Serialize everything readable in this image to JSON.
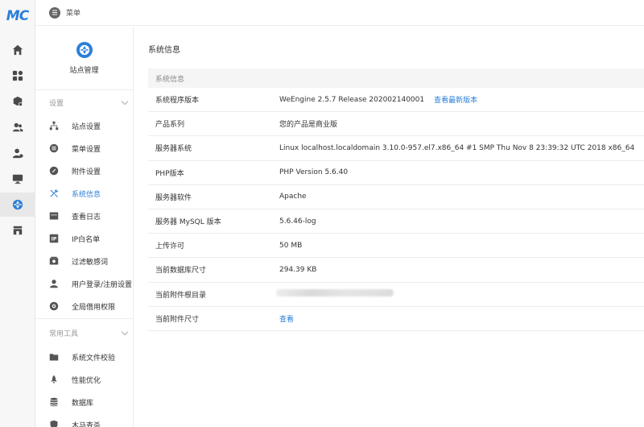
{
  "app": {
    "logo_text": "MC"
  },
  "topbar": {
    "title": "菜单",
    "icon": "menu-icon"
  },
  "rail": {
    "items": [
      {
        "name": "home-icon"
      },
      {
        "name": "apps-icon"
      },
      {
        "name": "package-icon"
      },
      {
        "name": "users-icon"
      },
      {
        "name": "user-settings-icon"
      },
      {
        "name": "monitor-icon"
      },
      {
        "name": "globe-icon",
        "active": true
      },
      {
        "name": "store-icon"
      }
    ]
  },
  "sidebar": {
    "site_label": "站点管理",
    "group_settings": "设置",
    "group_tools": "常用工具",
    "items": [
      {
        "label": "站点设置",
        "icon": "sitemap-icon"
      },
      {
        "label": "菜单设置",
        "icon": "menu-list-icon"
      },
      {
        "label": "附件设置",
        "icon": "attachment-icon"
      },
      {
        "label": "系统信息",
        "icon": "wrench-icon",
        "active": true
      },
      {
        "label": "查看日志",
        "icon": "log-icon"
      },
      {
        "label": "IP白名单",
        "icon": "ip-icon"
      },
      {
        "label": "过滤敏感词",
        "icon": "filter-icon"
      },
      {
        "label": "用户登录/注册设置",
        "icon": "user-icon"
      },
      {
        "label": "全局借用权限",
        "icon": "permission-icon"
      }
    ],
    "tools": [
      {
        "label": "系统文件校验",
        "icon": "folder-icon"
      },
      {
        "label": "性能优化",
        "icon": "rocket-icon"
      },
      {
        "label": "数据库",
        "icon": "database-icon"
      },
      {
        "label": "木马查杀",
        "icon": "shield-icon"
      }
    ]
  },
  "main": {
    "page_title": "系统信息",
    "table_header": "系统信息",
    "rows": [
      {
        "key": "系统程序版本",
        "value": "WeEngine 2.5.7 Release 202002140001",
        "link": "查看最新版本"
      },
      {
        "key": "产品系列",
        "value": "您的产品是商业版"
      },
      {
        "key": "服务器系统",
        "value": "Linux localhost.localdomain 3.10.0-957.el7.x86_64 #1 SMP Thu Nov 8 23:39:32 UTC 2018 x86_64"
      },
      {
        "key": "PHP版本",
        "value": "PHP Version 5.6.40"
      },
      {
        "key": "服务器软件",
        "value": "Apache"
      },
      {
        "key": "服务器 MySQL 版本",
        "value": "5.6.46-log"
      },
      {
        "key": "上传许可",
        "value": "50 MB"
      },
      {
        "key": "当前数据库尺寸",
        "value": "294.39 KB"
      },
      {
        "key": "当前附件根目录",
        "value": ""
      },
      {
        "key": "当前附件尺寸",
        "link_value": "查看"
      }
    ]
  },
  "colors": {
    "accent": "#2b7fd8",
    "text": "#333333",
    "muted": "#999999"
  }
}
